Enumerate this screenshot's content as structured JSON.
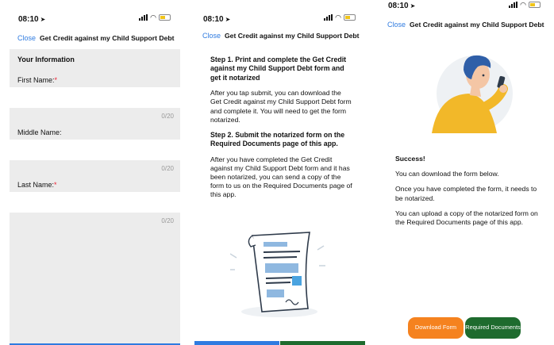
{
  "status": {
    "time": "08:10",
    "location_icon": "location-arrow-icon",
    "wifi_icon": "wifi-icon",
    "battery_icon": "battery-icon"
  },
  "nav": {
    "close_label": "Close",
    "title": "Get Credit against my Child Support Debt"
  },
  "form": {
    "section_title": "Your Information",
    "required_mark": "*",
    "fields": [
      {
        "label": "First Name:",
        "required": true,
        "counter": "0/20"
      },
      {
        "label": "Middle Name:",
        "required": false,
        "counter": "0/20"
      },
      {
        "label": "Last Name:",
        "required": true,
        "counter": "0/20"
      }
    ]
  },
  "instructions": {
    "step1_heading": "Step 1. Print and complete the Get Credit against my Child Support Debt form and get it notarized",
    "step1_body": "After you tap submit, you can download the Get Credit against my Child Support Debt form and complete it. You will need to get the form notarized.",
    "step2_heading": "Step 2. Submit the notarized form on the Required Documents page of this app.",
    "step2_body": "After you have completed the Get Credit against my Child Support Debt form and it has been notarized, you can send a copy of the form to us on the Required Documents page of this app."
  },
  "success": {
    "title": "Success!",
    "line1": "You can download the form below.",
    "line2": "Once you have completed the form, it needs to be notarized.",
    "line3": "You can upload a copy of the notarized form on the Required Documents page of this app.",
    "download_label": "Download Form",
    "required_docs_label": "Required Documents"
  },
  "colors": {
    "link": "#2f7be0",
    "required": "#e23333",
    "orange": "#f5821f",
    "green": "#1e6b2e",
    "form_bg": "#ececec"
  }
}
